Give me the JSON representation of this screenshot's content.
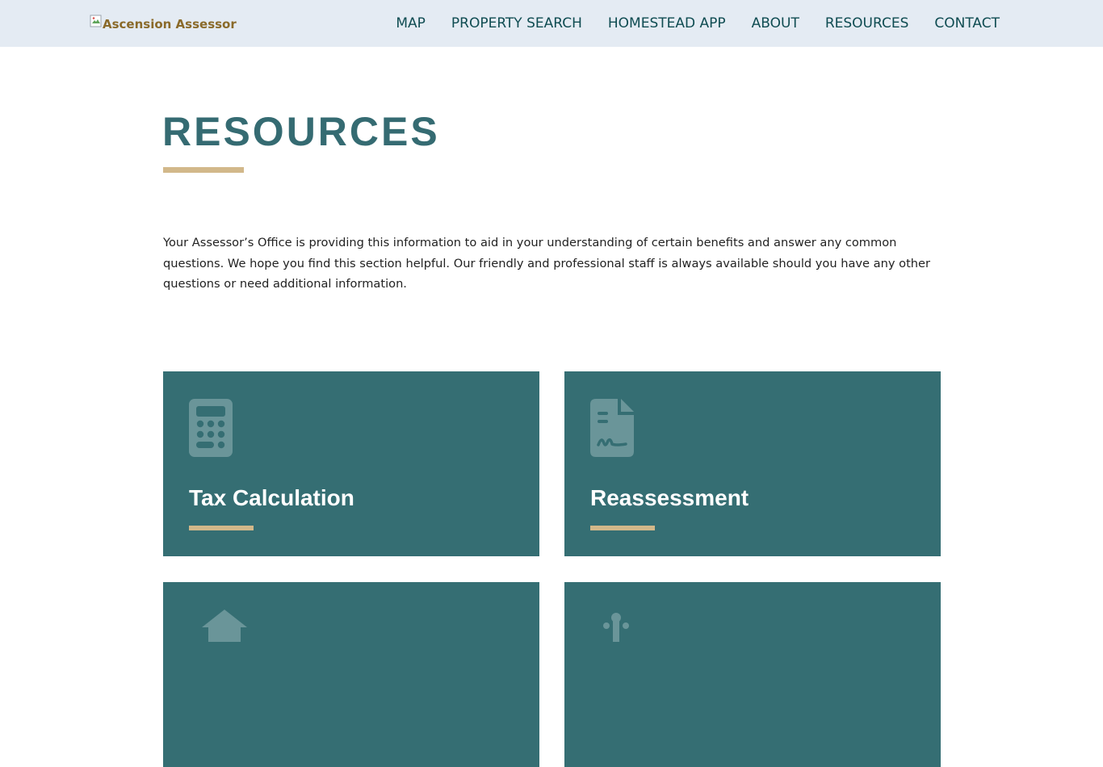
{
  "header": {
    "logo_alt": "Ascension Assessor",
    "nav": [
      "MAP",
      "PROPERTY SEARCH",
      "HOMESTEAD APP",
      "ABOUT",
      "RESOURCES",
      "CONTACT"
    ]
  },
  "main": {
    "title": "RESOURCES",
    "intro": "Your Assessor’s Office is providing this information to aid in your understanding of certain benefits and answer any common questions. We hope you find this section helpful. Our friendly and professional staff is always available should you have any other questions or need additional information.",
    "cards": [
      {
        "title": "Tax Calculation",
        "icon": "calculator-icon"
      },
      {
        "title": "Reassessment",
        "icon": "signed-document-icon"
      },
      {
        "title": "",
        "icon": "home-icon"
      },
      {
        "title": "",
        "icon": "badge-icon"
      }
    ]
  },
  "colors": {
    "header_bg": "#e4ebf3",
    "nav_text": "#0f4c52",
    "title": "#356b72",
    "accent": "#d2b88a",
    "card_bg": "#356e73"
  }
}
